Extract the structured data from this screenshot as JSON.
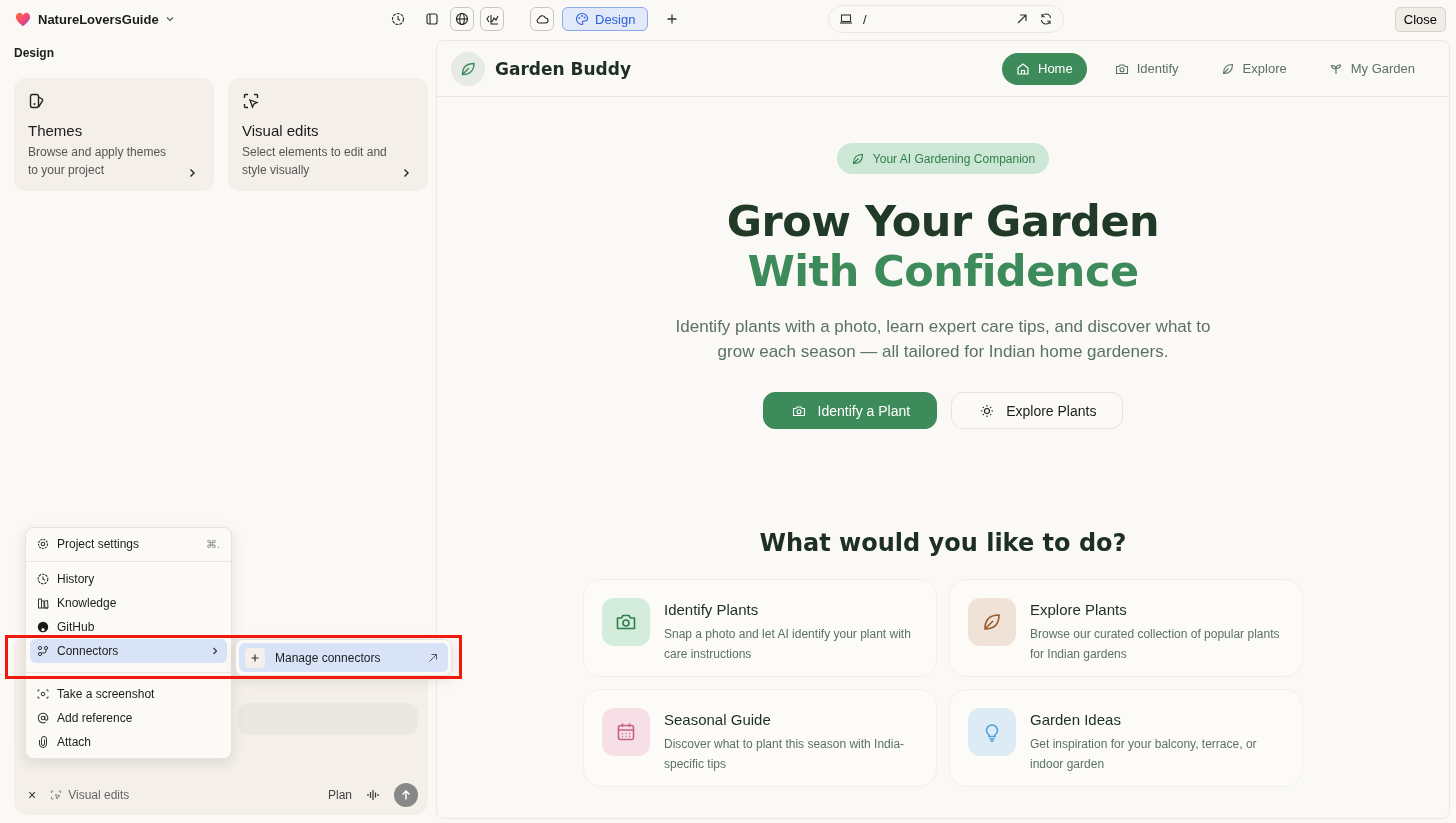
{
  "topbar": {
    "project": "NatureLoversGuide",
    "tabs": [
      {
        "label": "Design",
        "selected": true
      }
    ],
    "url": "/",
    "close": "Close"
  },
  "sidebar": {
    "title": "Design",
    "cards": [
      {
        "title": "Themes",
        "description": "Browse and apply themes to your project"
      },
      {
        "title": "Visual edits",
        "description": "Select elements to edit and style visually"
      }
    ]
  },
  "menu": {
    "items": [
      {
        "label": "Project settings",
        "shortcut": "⌘.",
        "selected": false,
        "submenu": false
      },
      {
        "label": "History",
        "selected": false,
        "submenu": false
      },
      {
        "label": "Knowledge",
        "selected": false,
        "submenu": false
      },
      {
        "label": "GitHub",
        "selected": false,
        "submenu": false
      },
      {
        "label": "Connectors",
        "selected": true,
        "submenu": true
      },
      {
        "label": "Take a screenshot",
        "selected": false,
        "submenu": false
      },
      {
        "label": "Add reference",
        "selected": false,
        "submenu": false
      },
      {
        "label": "Attach",
        "selected": false,
        "submenu": false
      }
    ],
    "submenu": {
      "items": [
        {
          "label": "Manage connectors",
          "selected": true
        }
      ]
    }
  },
  "composer": {
    "close": "×",
    "chip": "Visual edits",
    "mode": "Plan"
  },
  "preview": {
    "brand": "Garden Buddy",
    "nav": [
      {
        "label": "Home",
        "selected": true
      },
      {
        "label": "Identify",
        "selected": false
      },
      {
        "label": "Explore",
        "selected": false
      },
      {
        "label": "My Garden",
        "selected": false
      }
    ],
    "badge": "Your AI Gardening Companion",
    "headline": "Grow Your Garden",
    "headline_accent": "With Confidence",
    "intro": "Identify plants with a photo, learn expert care tips, and discover what to grow each season — all tailored for Indian home gardeners.",
    "buttons": [
      {
        "label": "Identify a Plant",
        "kind": "primary"
      },
      {
        "label": "Explore Plants",
        "kind": "secondary"
      }
    ],
    "section_title": "What would you like to do?",
    "features": [
      {
        "title": "Identify Plants",
        "description": "Snap a photo and let AI identify your plant with care instructions",
        "color": "#d3ecdc"
      },
      {
        "title": "Explore Plants",
        "description": "Browse our curated collection of popular plants for Indian gardens",
        "color": "#f0e2d6"
      },
      {
        "title": "Seasonal Guide",
        "description": "Discover what to plant this season with India-specific tips",
        "color": "#f6dfe7"
      },
      {
        "title": "Garden Ideas",
        "description": "Get inspiration for your balcony, terrace, or indoor garden",
        "color": "#ddebf6"
      }
    ]
  }
}
